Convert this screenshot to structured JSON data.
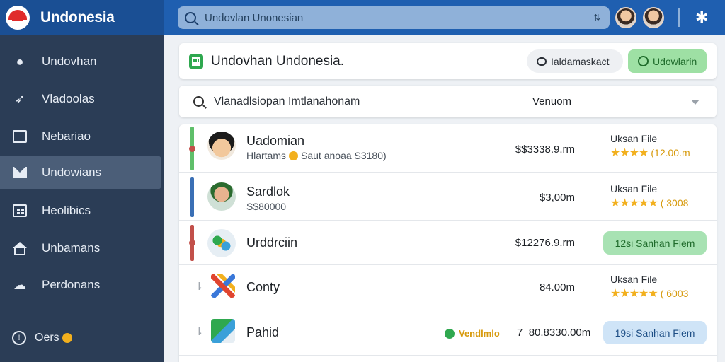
{
  "app": {
    "brand": "Undonesia"
  },
  "search": {
    "value": "Undovlan Unonesian",
    "placeholder": "Undovlan Unonesian"
  },
  "sidebar": {
    "items": [
      {
        "label": "Undovhan",
        "icon": "globe-icon"
      },
      {
        "label": "Vladoolas",
        "icon": "bird-icon"
      },
      {
        "label": "Nebariao",
        "icon": "monitor-icon"
      },
      {
        "label": "Undowians",
        "icon": "mail-icon",
        "active": true
      },
      {
        "label": "Heolibics",
        "icon": "grid-icon"
      },
      {
        "label": "Unbamans",
        "icon": "home-icon"
      },
      {
        "label": "Perdonans",
        "icon": "cloud-icon"
      }
    ],
    "footer": {
      "label": "Oers"
    }
  },
  "header": {
    "title": "Undovhan Undonesia.",
    "secondary_button": "Ialdamaskact",
    "primary_button": "Udowlarin"
  },
  "filter": {
    "placeholder": "Vlanadlsiopan Imtlanahonam",
    "sort_value": "Venuom"
  },
  "rows": [
    {
      "name": "Uadomian",
      "subtitle_left": "Hlartams",
      "subtitle_right": "Saut anoaa S3180)",
      "amount": "$$3338.9.rm",
      "rating_label": "Uksan File",
      "stars": "★★★★",
      "rating_value": "(12.00.m",
      "bar_color": "#5fbf6a"
    },
    {
      "name": "Sardlok",
      "subtitle": "S$80000",
      "amount": "$3,00m",
      "rating_label": "Uksan File",
      "stars": "★★★★★",
      "rating_value": "( 3008",
      "bar_color": "#3a6fb5"
    },
    {
      "name": "Urddrciin",
      "amount": "$12276.9.rm",
      "status_pill": "12si Sanhan Flem",
      "bar_color": "#c2504a"
    },
    {
      "name": "Conty",
      "amount": "84.00m",
      "rating_label": "Uksan File",
      "stars": "★★★★★",
      "rating_value": "( 6003",
      "arrow": "⇂"
    },
    {
      "name": "Pahid",
      "inline_status": "Vendlmlo",
      "amount_prefix": "7",
      "amount": "80.8330.00m",
      "status_pill": "19si Sanhan Flem",
      "arrow": "⇂"
    }
  ],
  "colors": {
    "topbar": "#1f5fb0",
    "sidebar": "#2b3d56",
    "accent_green": "#2fa84f",
    "star": "#f2b01e"
  }
}
